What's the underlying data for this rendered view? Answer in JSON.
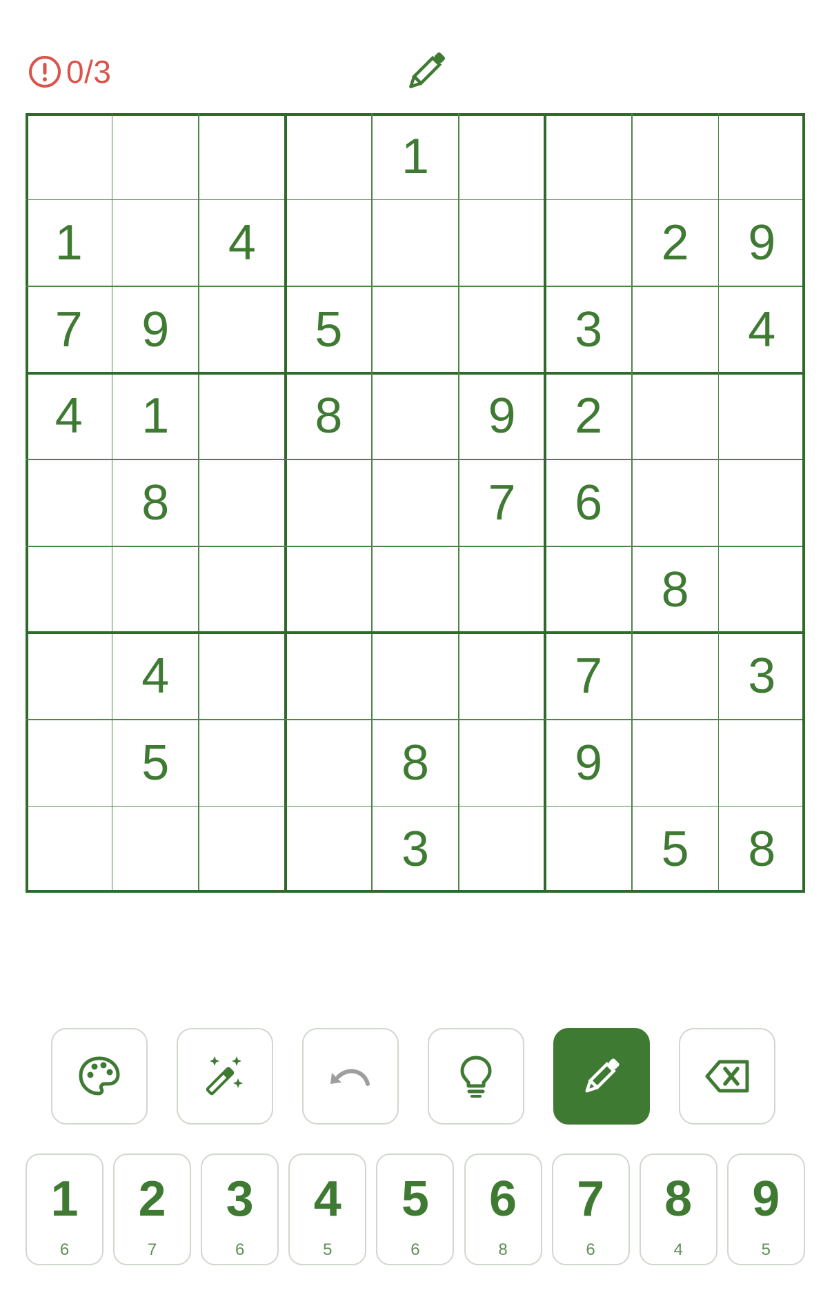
{
  "header": {
    "mistakes_text": "0/3",
    "mistakes_icon": "alert-circle-icon",
    "mode_icon": "pencil-icon"
  },
  "colors": {
    "accent": "#3f7a33",
    "grid_thick": "#2f6a2b",
    "grid_thin": "#4d8546",
    "error": "#d9544a",
    "button_border": "#cfd8cc",
    "undo_icon": "#9e9e9e"
  },
  "board": {
    "rows": [
      [
        "",
        "",
        "",
        "",
        "1",
        "",
        "",
        "",
        ""
      ],
      [
        "1",
        "",
        "4",
        "",
        "",
        "",
        "",
        "2",
        "9"
      ],
      [
        "7",
        "9",
        "",
        "5",
        "",
        "",
        "3",
        "",
        "4"
      ],
      [
        "4",
        "1",
        "",
        "8",
        "",
        "9",
        "2",
        "",
        ""
      ],
      [
        "",
        "8",
        "",
        "",
        "",
        "7",
        "6",
        "",
        ""
      ],
      [
        "",
        "",
        "",
        "",
        "",
        "",
        "",
        "8",
        ""
      ],
      [
        "",
        "4",
        "",
        "",
        "",
        "",
        "7",
        "",
        "3"
      ],
      [
        "",
        "5",
        "",
        "",
        "8",
        "",
        "9",
        "",
        ""
      ],
      [
        "",
        "",
        "",
        "",
        "3",
        "",
        "",
        "5",
        "8"
      ]
    ]
  },
  "tools": [
    {
      "icon": "palette-icon",
      "active": false
    },
    {
      "icon": "magic-wand-icon",
      "active": false
    },
    {
      "icon": "undo-icon",
      "active": false
    },
    {
      "icon": "lightbulb-icon",
      "active": false
    },
    {
      "icon": "pencil-icon",
      "active": true
    },
    {
      "icon": "backspace-icon",
      "active": false
    }
  ],
  "numpad": [
    {
      "digit": "1",
      "count": "6"
    },
    {
      "digit": "2",
      "count": "7"
    },
    {
      "digit": "3",
      "count": "6"
    },
    {
      "digit": "4",
      "count": "5"
    },
    {
      "digit": "5",
      "count": "6"
    },
    {
      "digit": "6",
      "count": "8"
    },
    {
      "digit": "7",
      "count": "6"
    },
    {
      "digit": "8",
      "count": "4"
    },
    {
      "digit": "9",
      "count": "5"
    }
  ]
}
